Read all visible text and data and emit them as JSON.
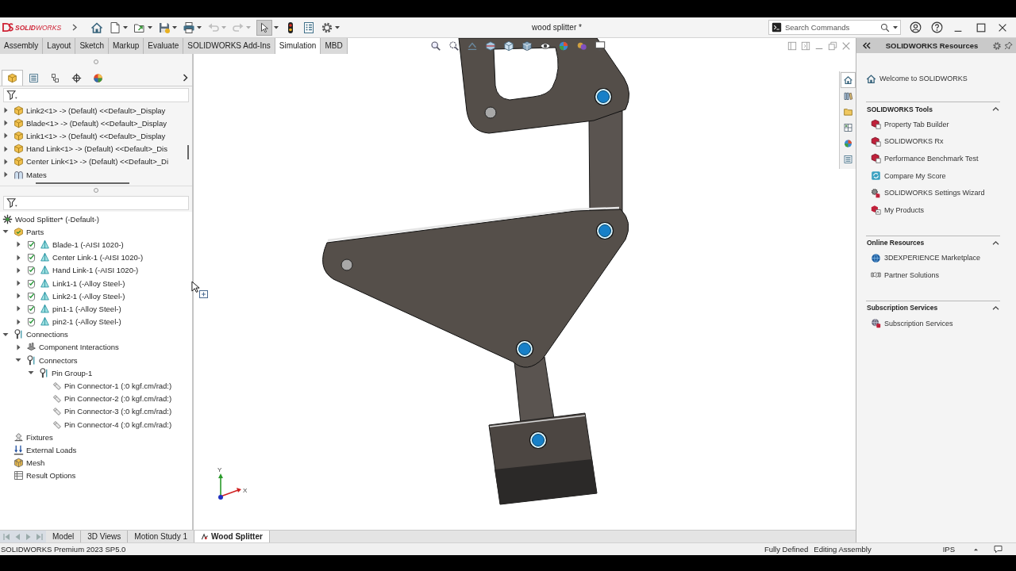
{
  "title_bar": {
    "logo": "**SOLID**WORKS",
    "toolbar": [
      {
        "kind": "home",
        "menu": false,
        "disabled": false,
        "pressed": false
      },
      {
        "kind": "new",
        "menu": true,
        "disabled": false,
        "pressed": false
      },
      {
        "kind": "open",
        "menu": true,
        "disabled": false,
        "pressed": false
      },
      {
        "kind": "save",
        "menu": true,
        "disabled": false,
        "pressed": false
      },
      {
        "kind": "print",
        "menu": true,
        "disabled": false,
        "pressed": false
      },
      {
        "kind": "undo",
        "menu": true,
        "disabled": true,
        "pressed": false
      },
      {
        "kind": "redo",
        "menu": true,
        "disabled": true,
        "pressed": false
      },
      {
        "kind": "select",
        "menu": true,
        "disabled": false,
        "pressed": true
      },
      {
        "kind": "rebuild",
        "menu": false,
        "disabled": false,
        "pressed": false
      },
      {
        "kind": "file_properties",
        "menu": false,
        "disabled": false,
        "pressed": false
      },
      {
        "kind": "options",
        "menu": true,
        "disabled": false,
        "pressed": false
      }
    ],
    "document_title": "wood splitter *",
    "search": {
      "placeholder": "Search Commands"
    }
  },
  "command_tabs": [
    {
      "label": "Assembly",
      "selected": false
    },
    {
      "label": "Layout",
      "selected": false
    },
    {
      "label": "Sketch",
      "selected": false
    },
    {
      "label": "Markup",
      "selected": false
    },
    {
      "label": "Evaluate",
      "selected": false
    },
    {
      "label": "SOLIDWORKS Add-Ins",
      "selected": false
    },
    {
      "label": "Simulation",
      "selected": true
    },
    {
      "label": "MBD",
      "selected": false
    }
  ],
  "feature_manager": {
    "tabs": [
      {
        "kind": "feature_tree",
        "selected": true
      },
      {
        "kind": "property_manager",
        "selected": false
      },
      {
        "kind": "configuration_manager",
        "selected": false
      },
      {
        "kind": "dimxpert",
        "selected": false
      },
      {
        "kind": "display_manager",
        "selected": false
      }
    ],
    "components": [
      {
        "kind": "component",
        "label": "Link2<1> -> (Default) <<Default>_Display",
        "expanded": false
      },
      {
        "kind": "component",
        "label": "Blade<1> -> (Default) <<Default>_Display",
        "expanded": false
      },
      {
        "kind": "component",
        "label": "Link1<1> -> (Default) <<Default>_Display",
        "expanded": false
      },
      {
        "kind": "component",
        "label": "Hand Link<1> -> (Default) <<Default>_Dis",
        "expanded": false
      },
      {
        "kind": "component",
        "label": "Center Link<1> -> (Default) <<Default>_Di",
        "expanded": false
      },
      {
        "kind": "mates",
        "label": "Mates",
        "expanded": false
      }
    ]
  },
  "simulation_tree": {
    "root": {
      "kind": "assembly",
      "label": "Wood Splitter* (-Default-)",
      "children": [
        {
          "kind": "parts",
          "label": "Parts",
          "expanded": true,
          "children": [
            {
              "kind": "part",
              "label": "Blade-1 (-AISI 1020-)",
              "expanded": false
            },
            {
              "kind": "part",
              "label": "Center Link-1 (-AISI 1020-)",
              "expanded": false
            },
            {
              "kind": "part",
              "label": "Hand Link-1 (-AISI 1020-)",
              "expanded": false
            },
            {
              "kind": "part",
              "label": "Link1-1 (-Alloy Steel-)",
              "expanded": false
            },
            {
              "kind": "part",
              "label": "Link2-1 (-Alloy Steel-)",
              "expanded": false
            },
            {
              "kind": "part",
              "label": "pin1-1 (-Alloy Steel-)",
              "expanded": false
            },
            {
              "kind": "part",
              "label": "pin2-1 (-Alloy Steel-)",
              "expanded": false
            }
          ]
        },
        {
          "kind": "connections",
          "label": "Connections",
          "expanded": true,
          "children": [
            {
              "kind": "interactions",
              "label": "Component Interactions",
              "expanded": false
            },
            {
              "kind": "connectors",
              "label": "Connectors",
              "expanded": true,
              "children": [
                {
                  "kind": "pin_group",
                  "label": "Pin Group-1",
                  "expanded": true,
                  "children": [
                    {
                      "kind": "pin_connector",
                      "label": "Pin Connector-1 (:0 kgf.cm/rad:)"
                    },
                    {
                      "kind": "pin_connector",
                      "label": "Pin Connector-2 (:0 kgf.cm/rad:)"
                    },
                    {
                      "kind": "pin_connector",
                      "label": "Pin Connector-3 (:0 kgf.cm/rad:)"
                    },
                    {
                      "kind": "pin_connector",
                      "label": "Pin Connector-4 (:0 kgf.cm/rad:)"
                    }
                  ]
                }
              ]
            }
          ]
        },
        {
          "kind": "fixtures",
          "label": "Fixtures"
        },
        {
          "kind": "loads",
          "label": "External Loads"
        },
        {
          "kind": "mesh",
          "label": "Mesh"
        },
        {
          "kind": "results",
          "label": "Result Options"
        }
      ]
    }
  },
  "viewport": {
    "triad": {
      "x_label": "X",
      "y_label": "Y"
    }
  },
  "task_pane": {
    "title": "SOLIDWORKS Resources",
    "tabs": [
      {
        "kind": "home",
        "selected": true
      },
      {
        "kind": "design_library",
        "selected": false
      },
      {
        "kind": "file_explorer",
        "selected": false
      },
      {
        "kind": "view_palette",
        "selected": false
      },
      {
        "kind": "appearances",
        "selected": false
      },
      {
        "kind": "custom_properties",
        "selected": false
      }
    ],
    "welcome": "Welcome to SOLIDWORKS",
    "sections": [
      {
        "title": "SOLIDWORKS Tools",
        "expanded": true,
        "items": [
          {
            "kind": "property_tab_builder",
            "label": "Property Tab Builder"
          },
          {
            "kind": "rx",
            "label": "SOLIDWORKS Rx"
          },
          {
            "kind": "benchmark",
            "label": "Performance Benchmark Test"
          },
          {
            "kind": "compare_score",
            "label": "Compare My Score"
          },
          {
            "kind": "settings_wizard",
            "label": "SOLIDWORKS Settings Wizard"
          },
          {
            "kind": "my_products",
            "label": "My Products"
          }
        ]
      },
      {
        "title": "Online Resources",
        "expanded": true,
        "items": [
          {
            "kind": "marketplace",
            "label": "3DEXPERIENCE Marketplace"
          },
          {
            "kind": "partner",
            "label": "Partner Solutions"
          }
        ]
      },
      {
        "title": "Subscription Services",
        "expanded": true,
        "items": [
          {
            "kind": "subscription",
            "label": "Subscription Services"
          }
        ]
      }
    ]
  },
  "document_tabs": [
    {
      "kind": "model",
      "label": "Model",
      "selected": false
    },
    {
      "kind": "views",
      "label": "3D Views",
      "selected": false
    },
    {
      "kind": "motion",
      "label": "Motion Study 1",
      "selected": false
    },
    {
      "kind": "simulation_study",
      "label": "Wood Splitter",
      "selected": true
    }
  ],
  "status_bar": {
    "product": "SOLIDWORKS Premium 2023 SP5.0",
    "sketch_state": "Fully Defined",
    "mode": "Editing Assembly",
    "units": "IPS"
  }
}
